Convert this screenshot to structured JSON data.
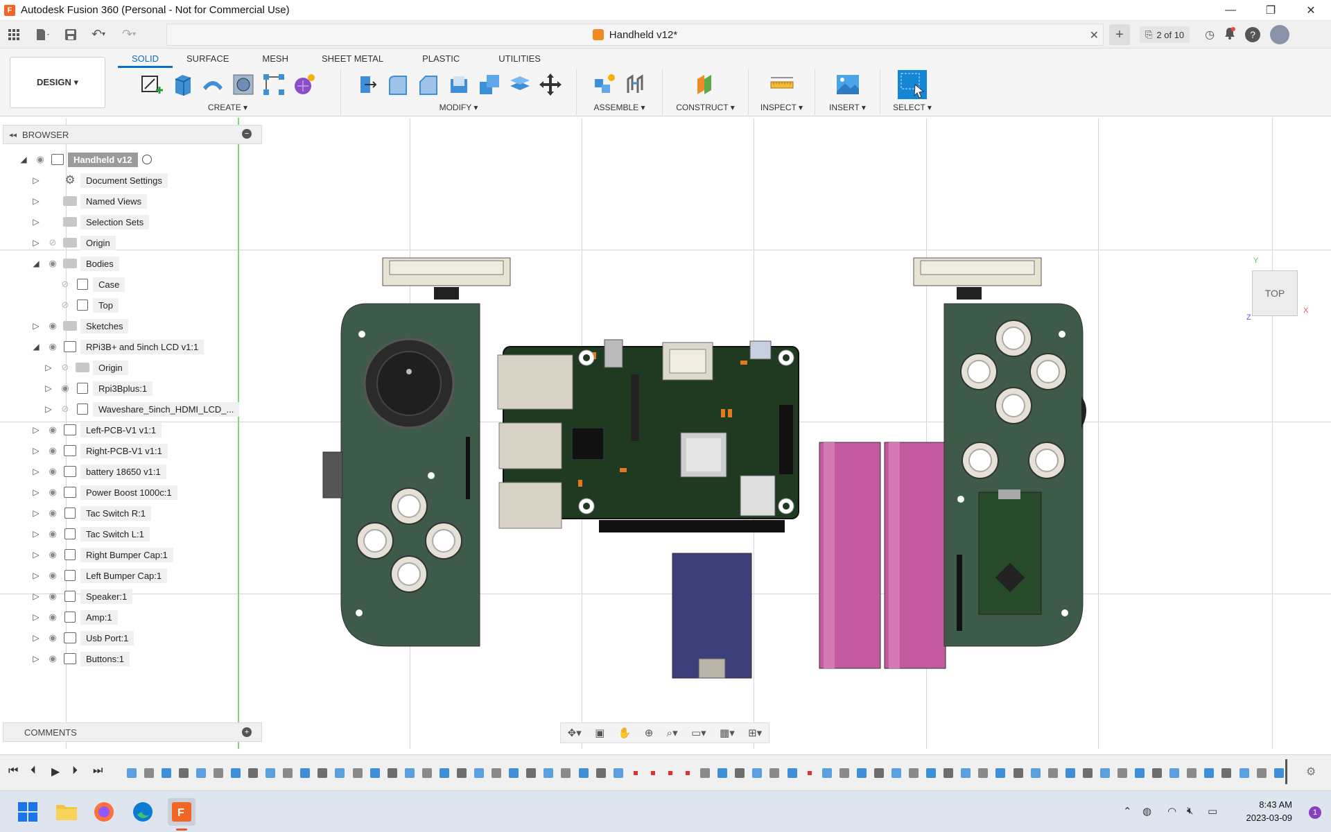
{
  "window": {
    "title": "Autodesk Fusion 360 (Personal - Not for Commercial Use)",
    "app_icon": "F"
  },
  "qat": {
    "doc_title": "Handheld v12*",
    "jobs": "2 of 10"
  },
  "ribbon": {
    "workspace": "DESIGN ▾",
    "tabs": [
      "SOLID",
      "SURFACE",
      "MESH",
      "SHEET METAL",
      "PLASTIC",
      "UTILITIES"
    ],
    "groups": {
      "create": "CREATE ▾",
      "modify": "MODIFY ▾",
      "assemble": "ASSEMBLE ▾",
      "construct": "CONSTRUCT ▾",
      "inspect": "INSPECT ▾",
      "insert": "INSERT ▾",
      "select": "SELECT ▾"
    }
  },
  "browser": {
    "title": "BROWSER",
    "root": "Handheld v12",
    "items": [
      {
        "label": "Document Settings"
      },
      {
        "label": "Named Views"
      },
      {
        "label": "Selection Sets"
      },
      {
        "label": "Origin"
      },
      {
        "label": "Bodies"
      },
      {
        "label": "Case"
      },
      {
        "label": "Top"
      },
      {
        "label": "Sketches"
      },
      {
        "label": "RPi3B+ and 5inch LCD v1:1"
      },
      {
        "label": "Origin"
      },
      {
        "label": "Rpi3Bplus:1"
      },
      {
        "label": "Waveshare_5inch_HDMI_LCD_..."
      },
      {
        "label": "Left-PCB-V1 v1:1"
      },
      {
        "label": "Right-PCB-V1 v1:1"
      },
      {
        "label": "battery 18650 v1:1"
      },
      {
        "label": "Power Boost 1000c:1"
      },
      {
        "label": "Tac Switch R:1"
      },
      {
        "label": "Tac Switch L:1"
      },
      {
        "label": "Right Bumper Cap:1"
      },
      {
        "label": "Left Bumper Cap:1"
      },
      {
        "label": "Speaker:1"
      },
      {
        "label": "Amp:1"
      },
      {
        "label": "Usb Port:1"
      },
      {
        "label": "Buttons:1"
      }
    ]
  },
  "comments": {
    "title": "COMMENTS"
  },
  "viewcube": {
    "face": "TOP",
    "axis_y": "Y",
    "axis_x": "X",
    "axis_z": "Z"
  },
  "colors": {
    "case_green": "#3e5a48",
    "pcb_green": "#203a22",
    "battery_pink": "#c45aa0",
    "powerboost_blue": "#3d3f7a",
    "accent_blue": "#0a6fc2"
  },
  "taskbar": {
    "time": "8:43 AM",
    "date": "2023-03-09",
    "notifications": "1"
  }
}
